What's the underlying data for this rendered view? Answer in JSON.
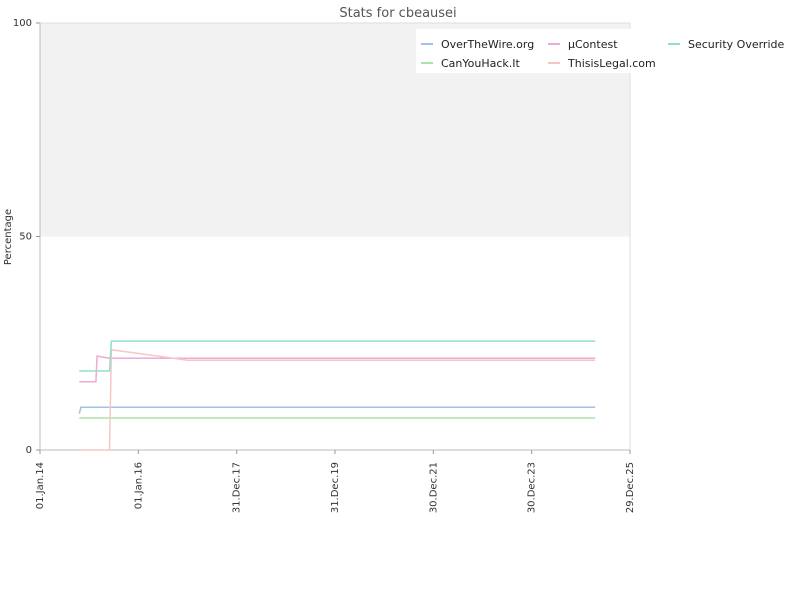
{
  "chart_data": {
    "type": "line",
    "title": "Stats for cbeausei",
    "xlabel": "",
    "ylabel": "Percentage",
    "xlim": [
      "2014-01-01",
      "2025-12-29"
    ],
    "ylim": [
      0,
      100
    ],
    "yticks": [
      0,
      50,
      100
    ],
    "xticks": [
      {
        "date": "2014-01-01",
        "label": "01.Jan.14"
      },
      {
        "date": "2016-01-01",
        "label": "01.Jan.16"
      },
      {
        "date": "2017-12-31",
        "label": "31.Dec.17"
      },
      {
        "date": "2019-12-31",
        "label": "31.Dec.19"
      },
      {
        "date": "2021-12-30",
        "label": "30.Dec.21"
      },
      {
        "date": "2023-12-30",
        "label": "30.Dec.23"
      },
      {
        "date": "2025-12-29",
        "label": "29.Dec.25"
      }
    ],
    "shaded_band": [
      50,
      100
    ],
    "grid": false,
    "legend_position": "top-right",
    "series": [
      {
        "name": "OverTheWire.org",
        "color": "#9fc3e8",
        "points": [
          [
            "2014-10-20",
            8.5
          ],
          [
            "2014-11-01",
            10
          ],
          [
            "2025-04-15",
            10
          ]
        ]
      },
      {
        "name": "CanYouHack.It",
        "color": "#a8e6a8",
        "points": [
          [
            "2014-10-20",
            7.5
          ],
          [
            "2025-04-15",
            7.5
          ]
        ]
      },
      {
        "name": "µContest",
        "color": "#f0a8d8",
        "points": [
          [
            "2014-10-20",
            16
          ],
          [
            "2015-02-20",
            16
          ],
          [
            "2015-03-01",
            22
          ],
          [
            "2015-06-01",
            21.5
          ],
          [
            "2025-04-15",
            21.5
          ]
        ]
      },
      {
        "name": "ThisisLegal.com",
        "color": "#f5c6c6",
        "points": [
          [
            "2014-10-20",
            0
          ],
          [
            "2015-06-01",
            0
          ],
          [
            "2015-06-15",
            23.5
          ],
          [
            "2017-01-01",
            21
          ],
          [
            "2025-04-15",
            21
          ]
        ]
      },
      {
        "name": "Security Override",
        "color": "#8fe0c8",
        "points": [
          [
            "2014-10-20",
            18.5
          ],
          [
            "2015-06-01",
            18.5
          ],
          [
            "2015-06-15",
            25.5
          ],
          [
            "2025-04-15",
            25.5
          ]
        ]
      }
    ]
  }
}
